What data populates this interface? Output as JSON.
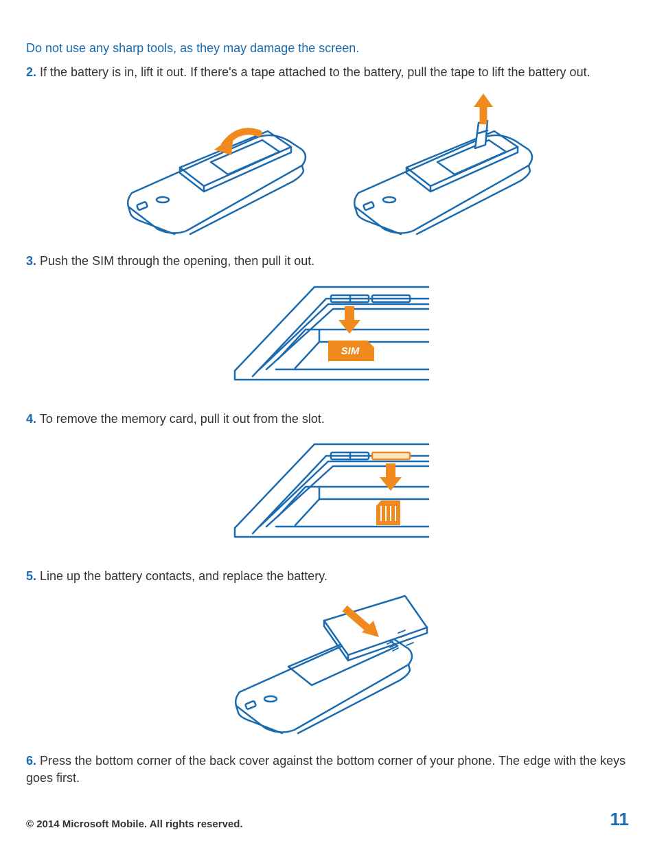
{
  "warningText": "Do not use any sharp tools, as they may damage the screen.",
  "step2": {
    "num": "2.",
    "text": " If the battery is in, lift it out. If there's a tape attached to the battery, pull the tape to lift the battery out."
  },
  "step3": {
    "num": "3.",
    "text": " Push the SIM through the opening, then pull it out."
  },
  "step4": {
    "num": "4.",
    "text": " To remove the memory card, pull it out from the slot."
  },
  "step5": {
    "num": "5.",
    "text": " Line up the battery contacts, and replace the battery."
  },
  "step6": {
    "num": "6.",
    "text": " Press the bottom corner of the back cover against the bottom corner of your phone. The edge with the keys goes first."
  },
  "simLabel": "SIM",
  "footer": {
    "copyright": "© 2014 Microsoft Mobile. All rights reserved.",
    "pageNum": "11"
  },
  "colors": {
    "line": "#1a6bb0",
    "accent": "#f08a1e"
  }
}
